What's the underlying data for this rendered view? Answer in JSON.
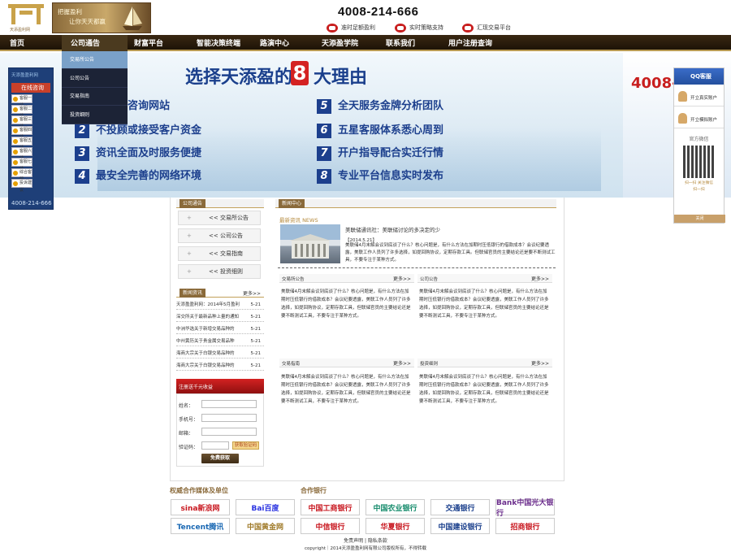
{
  "header": {
    "logo_text": "天添盈利网",
    "banner_line1": "把握盈利",
    "banner_line2": "让你天天都赢",
    "hotline": "4008-214-666",
    "features": [
      "准时足额盈利",
      "实时策略支持",
      "汇现交易平台"
    ]
  },
  "nav": {
    "items": [
      "首页",
      "公司通告",
      "财富平台",
      "智能决策终端",
      "路演中心",
      "天添盈学院",
      "联系我们",
      "用户注册查询"
    ],
    "active_index": 1
  },
  "dropdown": {
    "items": [
      "交易所公告",
      "公司公告",
      "交易指南",
      "投资细则"
    ]
  },
  "hero": {
    "title_pre": "选择天添盈的",
    "title_num": "8",
    "title_post": "大理由",
    "reasons": [
      {
        "n": "1",
        "text": "第三方咨询网站"
      },
      {
        "n": "2",
        "text": "不投顾或接受客户资金"
      },
      {
        "n": "3",
        "text": "资讯全面及时服务便捷"
      },
      {
        "n": "4",
        "text": "最安全完善的网络环境"
      },
      {
        "n": "5",
        "text": "全天服务金牌分析团队"
      },
      {
        "n": "6",
        "text": "五星客服体系悉心周到"
      },
      {
        "n": "7",
        "text": "开户指导配合实迁行情"
      },
      {
        "n": "8",
        "text": "专业平台信息实时发布"
      }
    ],
    "phone": "4008-2"
  },
  "left_float": {
    "title": "天添盈盈利网",
    "head": "在线咨询",
    "services": [
      "客服一线",
      "客服二线",
      "客服三线",
      "客服四线",
      "客服五线",
      "客服六线",
      "客服七线",
      "综合客服",
      "投诉建议"
    ],
    "phone": "4008-214-666"
  },
  "right_float": {
    "qq": "QQ客服",
    "apps": [
      "开立真实账户",
      "开立模拟账户"
    ],
    "weixin": "官方微信",
    "scan": "扫一扫 关注微信",
    "follow": "扫一扫",
    "close": "关闭"
  },
  "sidebar": {
    "notice_label": "公司通告",
    "links": [
      "<< 交易所公告",
      "<< 公司公告",
      "<< 交易指南",
      "<< 投资细则"
    ],
    "news_label": "新闻资讯",
    "more": "更多>>",
    "news": [
      {
        "title": "天添盈盈利网：2014年5月盈利",
        "date": "5-21"
      },
      {
        "title": "深交所关于最新品种上量的通知",
        "date": "5-21"
      },
      {
        "title": "中洲华选关于新增交易品种的",
        "date": "5-21"
      },
      {
        "title": "中州黄历关于贵金属交易品种",
        "date": "5-21"
      },
      {
        "title": "海商大宗关于白银交易品种的",
        "date": "5-21"
      },
      {
        "title": "海商大宗关于白银交易品种的",
        "date": "5-21"
      }
    ],
    "reg_label": "注册送千元收益",
    "reg_fields": [
      "姓名：",
      "手机号：",
      "邮箱：",
      "验证码："
    ],
    "captcha_btn": "获取验证码",
    "submit": "免费获取"
  },
  "content": {
    "section_label": "新闻中心",
    "latest_label": "最新资讯 NEWS",
    "headline": "美联储通讯社：美联储讨论的多决定的少",
    "headline_date": "【2014.5.21】",
    "headline_text": "美联储4月末解会议到底谈了什么？核心问题是，有什么方法在加期时压低银行的借款成本？会议纪要透露，美联工作人员列了许多选择，如提回购协议，定期存款工具。但联储官员的主要结论还是要不断测试工具，不要专注于某种方式。",
    "blocks": [
      {
        "label": "交易所公告",
        "more": "更多>>",
        "text": "美联储4月末解会议到底谈了什么？核心问题是，有什么方法在加期时压低银行的借款成本？会议纪要透露，美联工作人员列了许多选择，如提回购协议，定期存款工具，但联储官员的主要结论还是要不断测试工具，不要专注于某种方式。"
      },
      {
        "label": "公司公告",
        "more": "更多>>",
        "text": "美联储4月末解会议到底谈了什么？核心问题是，有什么方法在加期时压低银行的借款成本？会议纪要透露，美联工作人员列了许多选择，如提回购协议，定期存款工具，但联储官员的主要结论还是要不断测试工具，不要专注于某种方式。"
      },
      {
        "label": "交易指南",
        "more": "更多>>",
        "text": "美联储4月末解会议到底谈了什么？核心问题是，有什么方法在加期时压低银行的借款成本？会议纪要透露，美联工作人员列了许多选择，如提回购协议，定期存款工具，但联储官员的主要结论还是要不断测试工具，不要专注于某种方式。"
      },
      {
        "label": "投资细则",
        "more": "更多>>",
        "text": "美联储4月末解会议到底谈了什么？核心问题是，有什么方法在加期时压低银行的借款成本？会议纪要透露，美联工作人员列了许多选择，如提回购协议，定期存款工具，但联储官员的主要结论还是要不断测试工具，不要专注于某种方式。"
      }
    ]
  },
  "partners": {
    "media_label": "权威合作媒体及单位",
    "bank_label": "合作银行",
    "media": [
      {
        "name": "sina新浪网",
        "color": "#c8161e"
      },
      {
        "name": "Bai百度",
        "color": "#2932e1"
      },
      {
        "name": "Tencent腾讯",
        "color": "#1a68b3"
      },
      {
        "name": "中国黄金网",
        "color": "#a07b2a"
      }
    ],
    "banks": [
      {
        "name": "中国工商银行",
        "color": "#c8161e"
      },
      {
        "name": "中国农业银行",
        "color": "#138a6a"
      },
      {
        "name": "交通银行",
        "color": "#1a3f8c"
      },
      {
        "name": "Bank中国光大银行",
        "color": "#6b2d8c"
      },
      {
        "name": "中信银行",
        "color": "#c8161e"
      },
      {
        "name": "华夏银行",
        "color": "#c8161e"
      },
      {
        "name": "中国建设银行",
        "color": "#1a3f8c"
      },
      {
        "name": "招商银行",
        "color": "#c8161e"
      }
    ]
  },
  "footer": {
    "links": "免责声明 | 隐私条款",
    "copyright": "copyright｜2014天添盈盈利网有限公司版权所有，不得转载"
  }
}
